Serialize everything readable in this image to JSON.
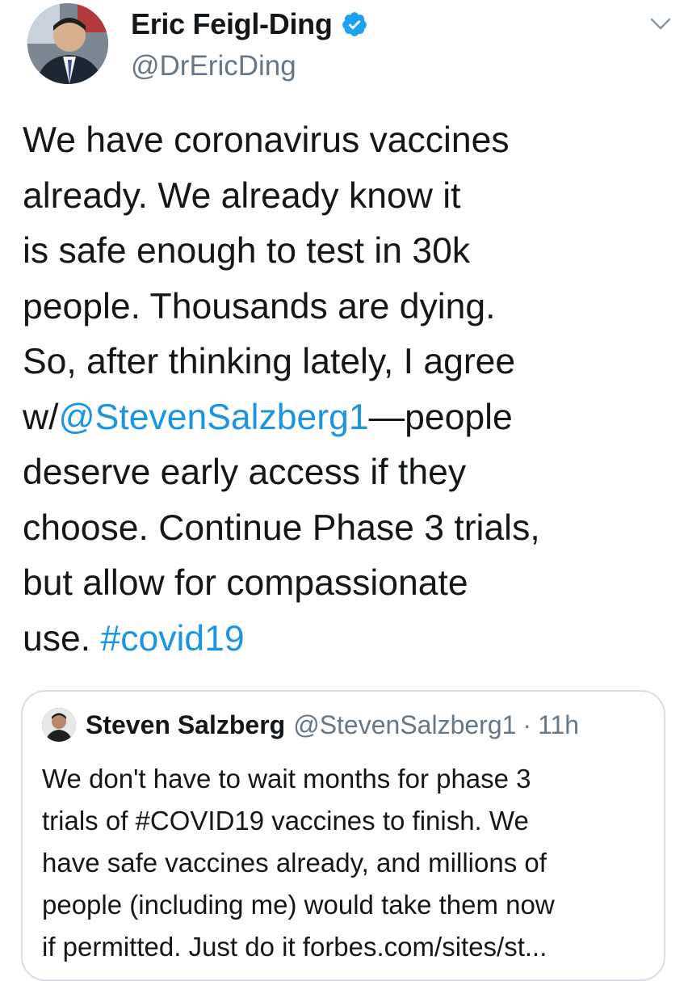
{
  "tweet": {
    "author": {
      "display_name": "Eric Feigl-Ding",
      "handle": "@DrEricDing",
      "verified": true,
      "avatar_icon": "avatar-photo"
    },
    "menu_icon": "chevron-down-icon",
    "text_parts": [
      "We have coronavirus vaccines\nalready. We already know it\nis safe enough to test in 30k\npeople. Thousands are dying.\nSo, after thinking lately, I agree\nw/",
      "@StevenSalzberg1",
      "—people\ndeserve early access if they\nchoose. Continue Phase 3 trials,\nbut allow for compassionate\nuse. ",
      "#covid19"
    ]
  },
  "quoted_tweet": {
    "display_name": "Steven Salzberg",
    "handle": "@StevenSalzberg1",
    "separator": "·",
    "time": "11h",
    "text": "We don't have to wait months for phase 3\ntrials of #COVID19 vaccines to finish. We\nhave safe vaccines already, and millions of\npeople (including me) would take them now\nif permitted. Just do it forbes.com/sites/st..."
  },
  "colors": {
    "link": "#1b95e0",
    "secondary_text": "#657786",
    "verified_badge": "#1da1f2",
    "card_border": "#d8dee3"
  }
}
